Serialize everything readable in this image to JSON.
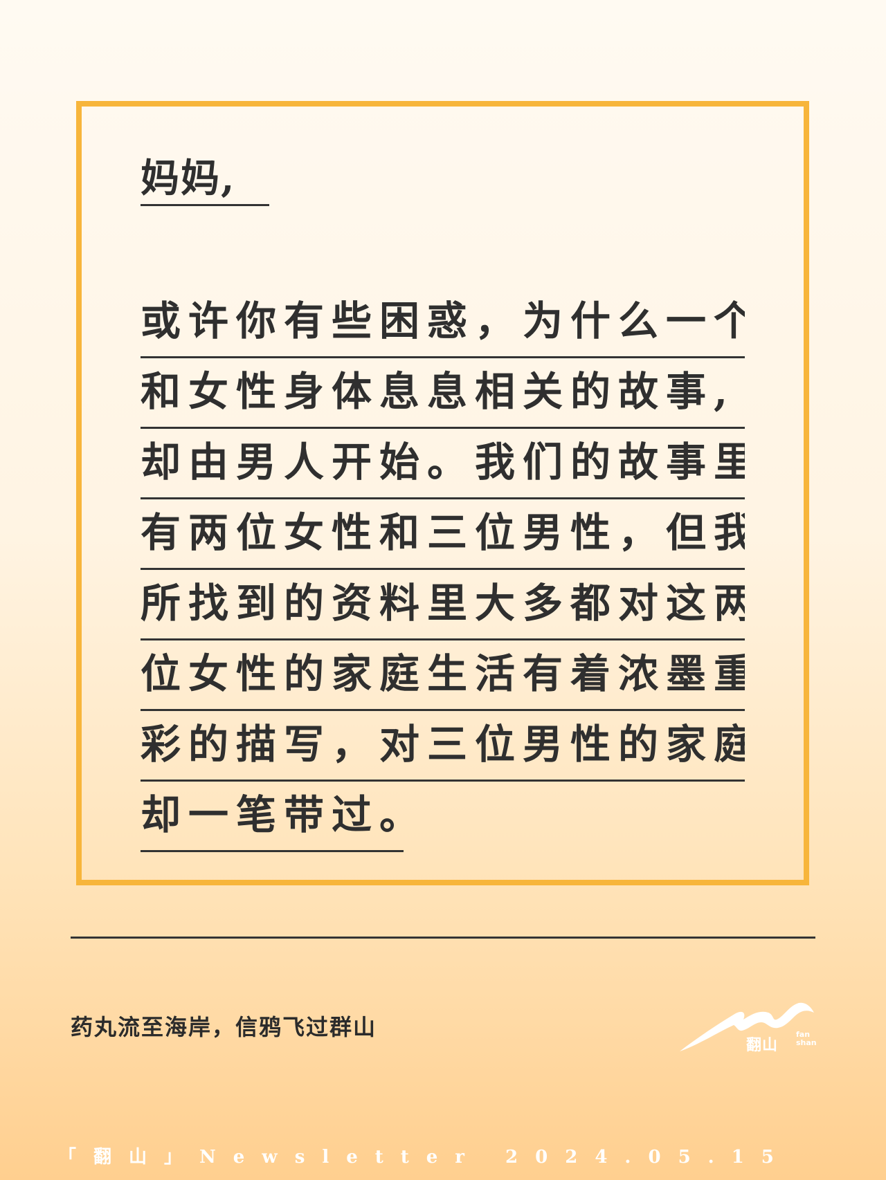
{
  "letter": {
    "salutation": "妈妈,",
    "lines": [
      "或许你有些困惑，为什么一个",
      "和女性身体息息相关的故事,",
      "却由男人开始。我们的故事里",
      "有两位女性和三位男性，但我",
      "所找到的资料里大多都对这两",
      "位女性的家庭生活有着浓墨重",
      "彩的描写，对三位男性的家庭",
      "却一笔带过。"
    ]
  },
  "tagline": "药丸流至海岸，信鸦飞过群山",
  "logo": {
    "cn": "翻山",
    "en_top": "fan",
    "en_bottom": "shan"
  },
  "footer": {
    "text": "「翻山」Newsletter 2024.05.15"
  },
  "colors": {
    "frame": "#f7b53b",
    "text": "#2f2f2f",
    "footer_text": "#ffffff"
  }
}
